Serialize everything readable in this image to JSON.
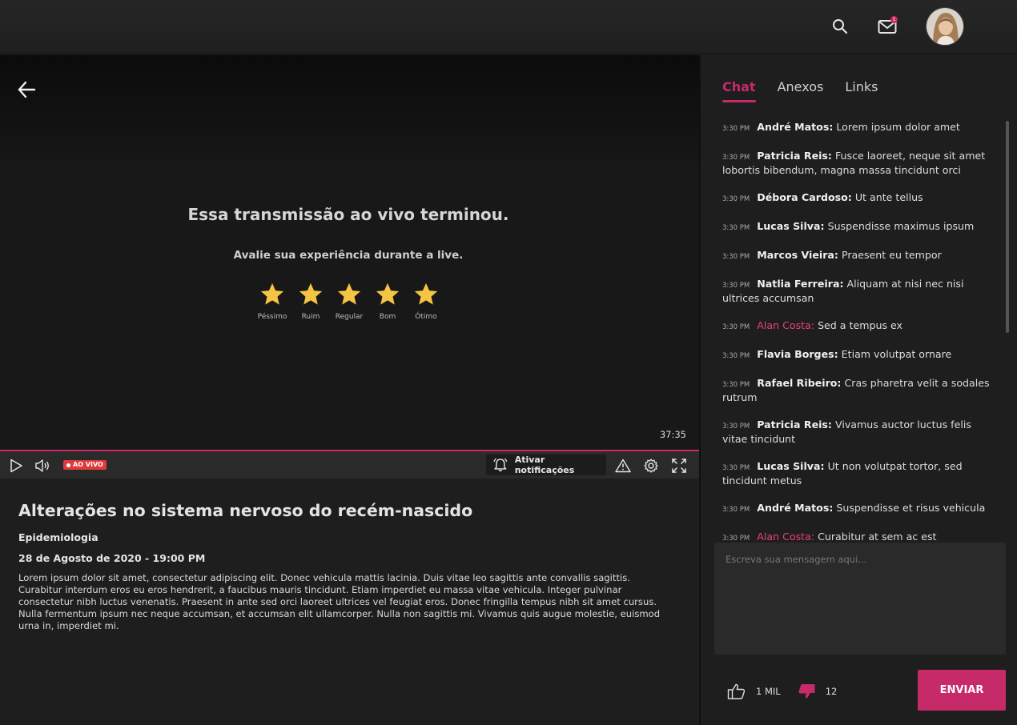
{
  "header": {
    "search_icon": "search-icon",
    "mail_icon": "mail-icon",
    "mail_badge": "1",
    "avatar": "user-avatar"
  },
  "player": {
    "ended_title": "Essa transmissão ao vivo terminou.",
    "rating_prompt": "Avalie sua experiência durante a live.",
    "rating_labels": [
      "Péssimo",
      "Ruim",
      "Regular",
      "Bom",
      "Ótimo"
    ],
    "timecode": "37:35",
    "live_label": "AO VIVO",
    "notify_label": "Ativar notificações",
    "colors": {
      "accent": "#c72a68",
      "star": "#f5c443",
      "live": "#e03a3a"
    }
  },
  "info": {
    "title": "Alterações no sistema nervoso do recém-nascido",
    "category": "Epidemiologia",
    "date": "28 de Agosto de 2020 - 19:00 PM",
    "description": "Lorem ipsum dolor sit amet, consectetur adipiscing elit. Donec vehicula mattis lacinia. Duis vitae leo sagittis ante convallis sagittis. Curabitur interdum eros eu eros hendrerit, a faucibus mauris tincidunt. Etiam imperdiet eu massa vitae vehicula. Integer pulvinar consectetur nibh luctus venenatis. Praesent in ante sed orci laoreet ultrices vel feugiat eros. Donec fringilla tempus nibh sit amet cursus. Nulla fermentum ipsum nec neque accumsan, et accumsan elit ullamcorper. Nulla non sagittis mi. Vivamus quis augue molestie, euismod urna in, imperdiet mi."
  },
  "chat": {
    "tabs": [
      "Chat",
      "Anexos",
      "Links"
    ],
    "messages": [
      {
        "time": "3:30 PM",
        "name": "André Matos:",
        "text": "Lorem ipsum dolor amet",
        "highlight": false
      },
      {
        "time": "3:30 PM",
        "name": "Patricia Reis:",
        "text": "Fusce laoreet, neque sit amet lobortis bibendum, magna massa tincidunt orci",
        "highlight": false
      },
      {
        "time": "3:30 PM",
        "name": "Débora Cardoso:",
        "text": "Ut ante tellus",
        "highlight": false
      },
      {
        "time": "3:30 PM",
        "name": "Lucas Silva:",
        "text": "Suspendisse maximus ipsum",
        "highlight": false
      },
      {
        "time": "3:30 PM",
        "name": "Marcos Vieira:",
        "text": "Praesent eu tempor",
        "highlight": false
      },
      {
        "time": "3:30 PM",
        "name": "Natlia Ferreira:",
        "text": "Aliquam at nisi nec nisi ultrices accumsan",
        "highlight": false
      },
      {
        "time": "3:30 PM",
        "name": "Alan Costa:",
        "text": "Sed a tempus ex",
        "highlight": true
      },
      {
        "time": "3:30 PM",
        "name": "Flavia Borges:",
        "text": "Etiam volutpat ornare",
        "highlight": false
      },
      {
        "time": "3:30 PM",
        "name": "Rafael Ribeiro:",
        "text": "Cras pharetra velit a sodales rutrum",
        "highlight": false
      },
      {
        "time": "3:30 PM",
        "name": "Patricia Reis:",
        "text": "Vivamus auctor luctus felis vitae tincidunt",
        "highlight": false
      },
      {
        "time": "3:30 PM",
        "name": "Lucas Silva:",
        "text": "Ut non volutpat tortor, sed tincidunt metus",
        "highlight": false
      },
      {
        "time": "3:30 PM",
        "name": "André Matos:",
        "text": "Suspendisse et risus vehicula",
        "highlight": false
      },
      {
        "time": "3:30 PM",
        "name": "Alan Costa:",
        "text": "Curabitur at sem ac est",
        "highlight": true
      }
    ],
    "input_placeholder": "Escreva sua mensagem aqui...",
    "likes": "1 MIL",
    "dislikes": "12",
    "send_label": "ENVIAR"
  }
}
